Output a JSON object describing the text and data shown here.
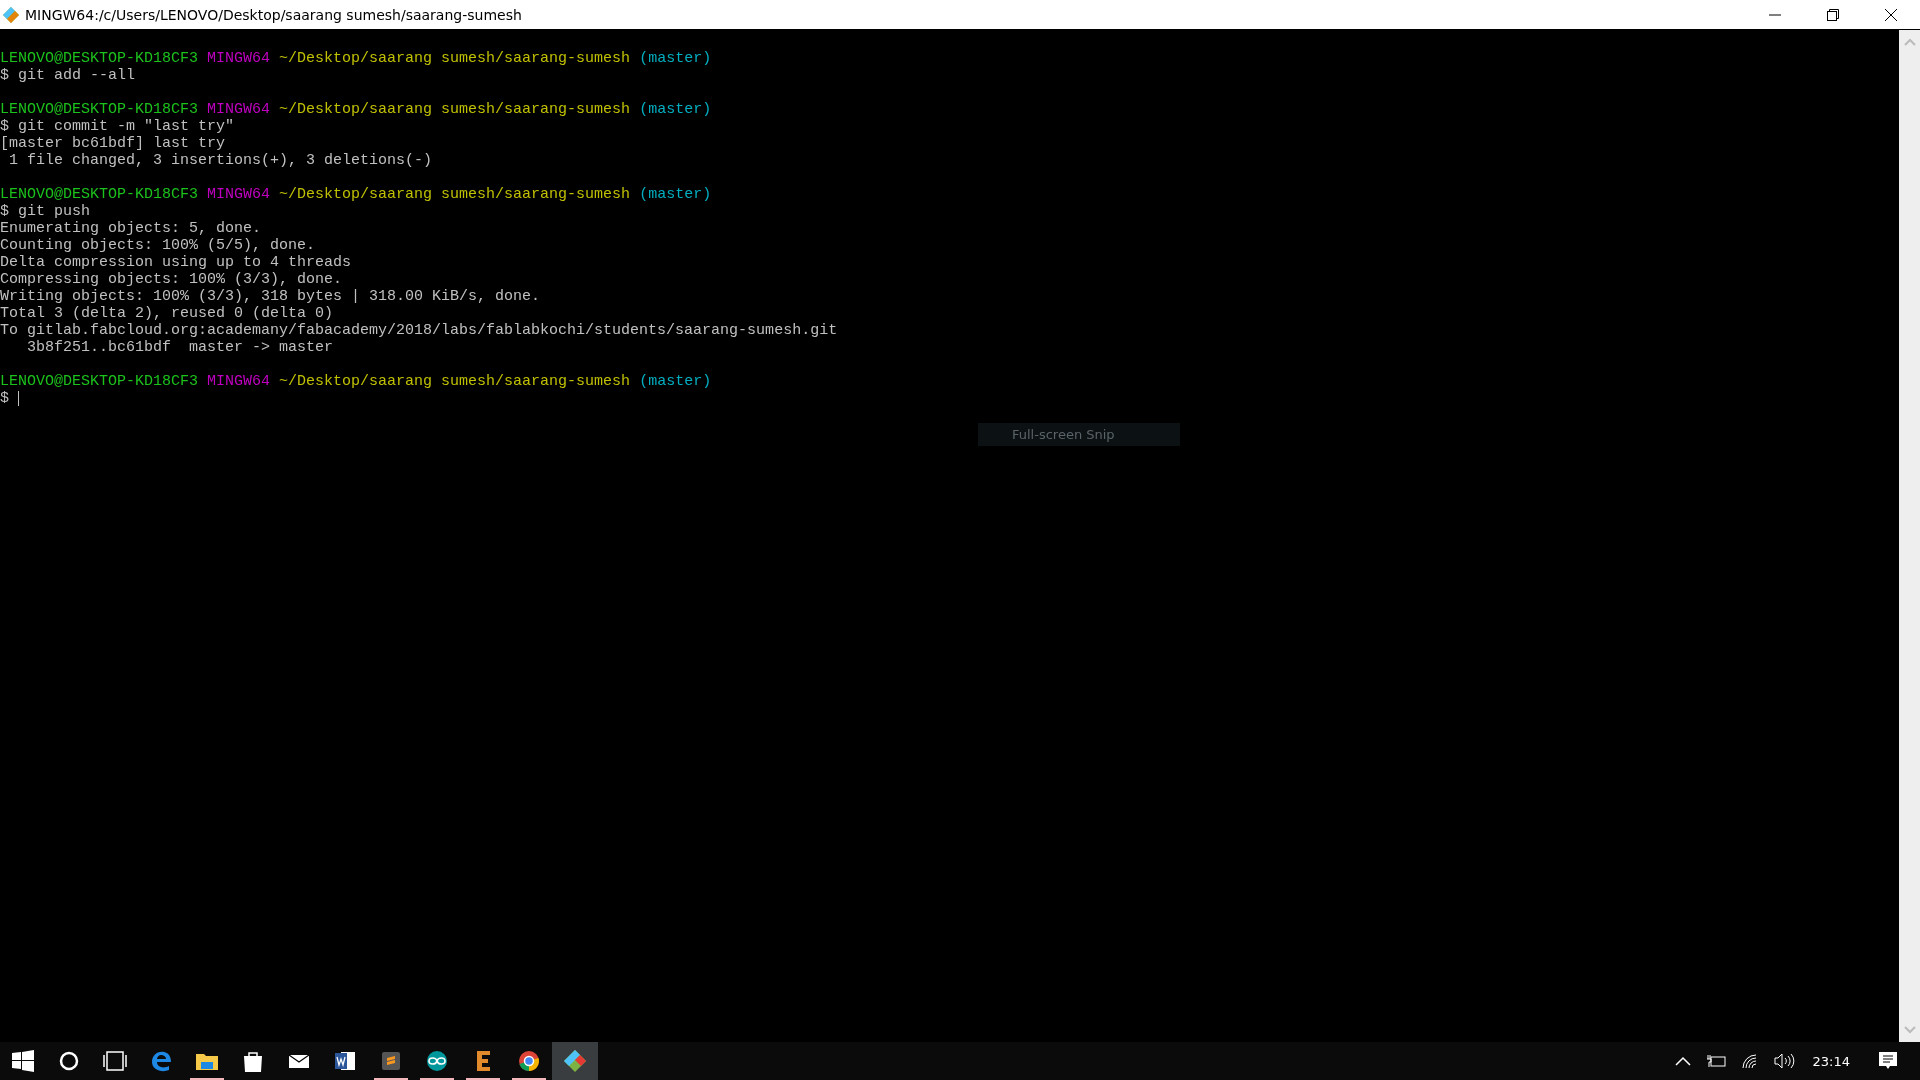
{
  "window": {
    "title": "MINGW64:/c/Users/LENOVO/Desktop/saarang sumesh/saarang-sumesh"
  },
  "terminal": {
    "lines": [
      {
        "kind": "prompt",
        "user": "LENOVO@DESKTOP-KD18CF3",
        "shell": "MINGW64",
        "path": "~/Desktop/saarang sumesh/saarang-sumesh",
        "branch": "(master)"
      },
      {
        "kind": "input",
        "text": "$ git add --all"
      },
      {
        "kind": "blank"
      },
      {
        "kind": "prompt",
        "user": "LENOVO@DESKTOP-KD18CF3",
        "shell": "MINGW64",
        "path": "~/Desktop/saarang sumesh/saarang-sumesh",
        "branch": "(master)"
      },
      {
        "kind": "input",
        "text": "$ git commit -m \"last try\""
      },
      {
        "kind": "output",
        "text": "[master bc61bdf] last try"
      },
      {
        "kind": "output",
        "text": " 1 file changed, 3 insertions(+), 3 deletions(-)"
      },
      {
        "kind": "blank"
      },
      {
        "kind": "prompt",
        "user": "LENOVO@DESKTOP-KD18CF3",
        "shell": "MINGW64",
        "path": "~/Desktop/saarang sumesh/saarang-sumesh",
        "branch": "(master)"
      },
      {
        "kind": "input",
        "text": "$ git push"
      },
      {
        "kind": "output",
        "text": "Enumerating objects: 5, done."
      },
      {
        "kind": "output",
        "text": "Counting objects: 100% (5/5), done."
      },
      {
        "kind": "output",
        "text": "Delta compression using up to 4 threads"
      },
      {
        "kind": "output",
        "text": "Compressing objects: 100% (3/3), done."
      },
      {
        "kind": "output",
        "text": "Writing objects: 100% (3/3), 318 bytes | 318.00 KiB/s, done."
      },
      {
        "kind": "output",
        "text": "Total 3 (delta 2), reused 0 (delta 0)"
      },
      {
        "kind": "output",
        "text": "To gitlab.fabcloud.org:academany/fabacademy/2018/labs/fablabkochi/students/saarang-sumesh.git"
      },
      {
        "kind": "output",
        "text": "   3b8f251..bc61bdf  master -> master"
      },
      {
        "kind": "blank"
      },
      {
        "kind": "prompt",
        "user": "LENOVO@DESKTOP-KD18CF3",
        "shell": "MINGW64",
        "path": "~/Desktop/saarang sumesh/saarang-sumesh",
        "branch": "(master)"
      },
      {
        "kind": "input",
        "text": "$",
        "cursor": true
      }
    ]
  },
  "tooltip": {
    "text": "Full-screen Snip"
  },
  "taskbar": {
    "apps": [
      {
        "kind": "start",
        "running": false,
        "selected": false
      },
      {
        "kind": "search",
        "running": false,
        "selected": false
      },
      {
        "kind": "taskview",
        "running": false,
        "selected": false
      },
      {
        "kind": "edge",
        "running": false,
        "selected": false
      },
      {
        "kind": "explorer",
        "running": true,
        "selected": false
      },
      {
        "kind": "store",
        "running": false,
        "selected": false
      },
      {
        "kind": "mail",
        "running": false,
        "selected": false
      },
      {
        "kind": "word",
        "running": false,
        "selected": false
      },
      {
        "kind": "sublime",
        "running": true,
        "selected": false
      },
      {
        "kind": "arduino",
        "running": true,
        "selected": false
      },
      {
        "kind": "eagle",
        "running": true,
        "selected": false
      },
      {
        "kind": "chrome",
        "running": true,
        "selected": false
      },
      {
        "kind": "git",
        "running": false,
        "selected": true
      }
    ],
    "time": "23:14"
  }
}
